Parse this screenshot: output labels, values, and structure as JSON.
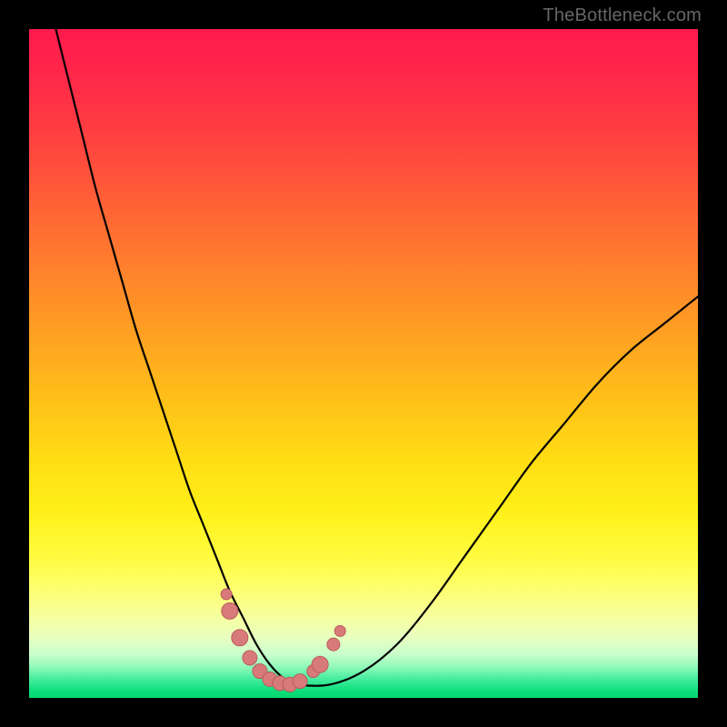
{
  "attribution": "TheBottleneck.com",
  "colors": {
    "page_bg": "#000000",
    "gradient_top": "#ff1a4d",
    "gradient_mid": "#ffdc14",
    "gradient_bottom": "#00d86e",
    "curve_stroke": "#000000",
    "marker_fill": "#d97a7a",
    "marker_stroke": "#b85c5c"
  },
  "chart_data": {
    "type": "line",
    "title": "",
    "xlabel": "",
    "ylabel": "",
    "xlim": [
      0,
      100
    ],
    "ylim": [
      0,
      100
    ],
    "series": [
      {
        "name": "bottleneck-curve",
        "x": [
          4,
          6,
          8,
          10,
          12,
          14,
          16,
          18,
          20,
          22,
          24,
          26,
          28,
          30,
          32,
          34,
          36,
          38,
          40,
          45,
          50,
          55,
          60,
          65,
          70,
          75,
          80,
          85,
          90,
          95,
          100
        ],
        "y": [
          100,
          92,
          84,
          76,
          69,
          62,
          55,
          49,
          43,
          37,
          31,
          26,
          21,
          16,
          12,
          8,
          5,
          3,
          2,
          2,
          4,
          8,
          14,
          21,
          28,
          35,
          41,
          47,
          52,
          56,
          60
        ]
      }
    ],
    "markers": {
      "name": "highlighted-points",
      "x": [
        29.5,
        30.0,
        31.5,
        33.0,
        34.5,
        36.0,
        37.5,
        39.0,
        40.5,
        42.5,
        43.5,
        45.5,
        46.5
      ],
      "y": [
        15.5,
        13.0,
        9.0,
        6.0,
        4.0,
        2.8,
        2.2,
        2.0,
        2.5,
        4.0,
        5.0,
        8.0,
        10.0
      ],
      "r": [
        6,
        9,
        9,
        8,
        8,
        8,
        8,
        8,
        8,
        7,
        9,
        7,
        6
      ]
    }
  }
}
